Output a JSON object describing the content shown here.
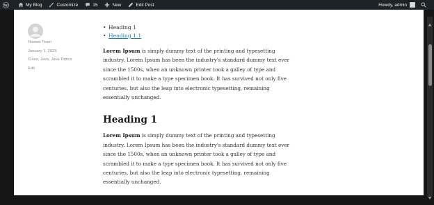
{
  "adminbar": {
    "site_name": "My Blog",
    "customize": "Customize",
    "comments_count": "15",
    "new_label": "New",
    "edit_post": "Edit Post",
    "howdy": "Howdy, admin"
  },
  "meta": {
    "author": "Hosted Team",
    "date": "January 1, 2025",
    "categories": "Class, Java, Java Topics",
    "edit": "Edit"
  },
  "toc": [
    {
      "label": "Heading 1",
      "link": false
    },
    {
      "label": "Heading 1.1",
      "link": true
    }
  ],
  "paragraph_lead": "Lorem Ipsum",
  "paragraph_rest_lines": [
    " is simply dummy text of the printing and typesetting",
    "industry. Lorem Ipsum has been the industry's standard dummy text ever",
    "since the 1500s, when an unknown printer took a galley of type and",
    "scrambled it to make a type specimen book. It has survived not only five",
    "centuries, but also the leap into electronic typesetting, remaining",
    "essentially unchanged."
  ],
  "heading1": "Heading 1",
  "paragraph2_lead": "Lorem Ipsum",
  "paragraph2_rest_lines": [
    " is simply dummy text of the printing and typesetting",
    "industry. Lorem Ipsum has been the industry's standard dummy text ever",
    "since the 1500s, when an unknown printer took a galley of type and",
    "scrambled it to make a type specimen book. It has survived not only five",
    "centuries, but also the leap into electronic typesetting, remaining",
    "essentially unchanged."
  ],
  "icons": {
    "wp": "wordpress-icon",
    "home": "home-icon",
    "brush": "paintbrush-icon",
    "comment": "comment-icon",
    "plus": "plus-icon",
    "pencil": "pencil-icon",
    "search": "search-icon"
  },
  "colors": {
    "adminbar_bg": "#1d2327",
    "link": "#1a7bb8",
    "page_bg": "#ffffff",
    "frame_bg": "#161616"
  }
}
